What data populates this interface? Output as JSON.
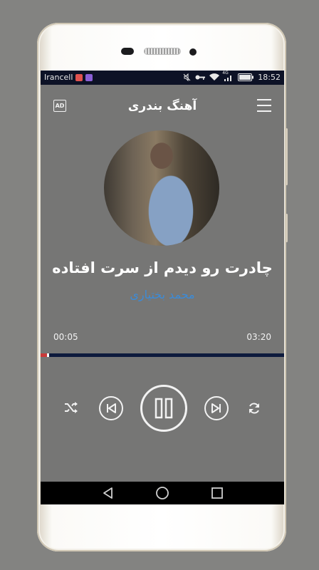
{
  "statusbar": {
    "carrier": "Irancell",
    "time": "18:52",
    "network": "4G"
  },
  "app": {
    "title": "آهنگ بندری",
    "ad_label": "AD"
  },
  "track": {
    "title": "چادرت رو دیدم از سرت افتاده",
    "artist": "محمد بختیاری",
    "elapsed": "00:05",
    "duration": "03:20",
    "progress": 0.025
  },
  "colors": {
    "screen_bg": "#767675",
    "artist": "#3d8bd6",
    "progress_bg": "#0d1a3d",
    "progress_fill": "#c93a3a"
  },
  "icons": {
    "shuffle": "shuffle-icon",
    "previous": "skip-previous-icon",
    "pause": "pause-icon",
    "next": "skip-next-icon",
    "repeat": "repeat-icon",
    "back": "nav-back-icon",
    "home": "nav-home-icon",
    "recents": "nav-recents-icon"
  }
}
